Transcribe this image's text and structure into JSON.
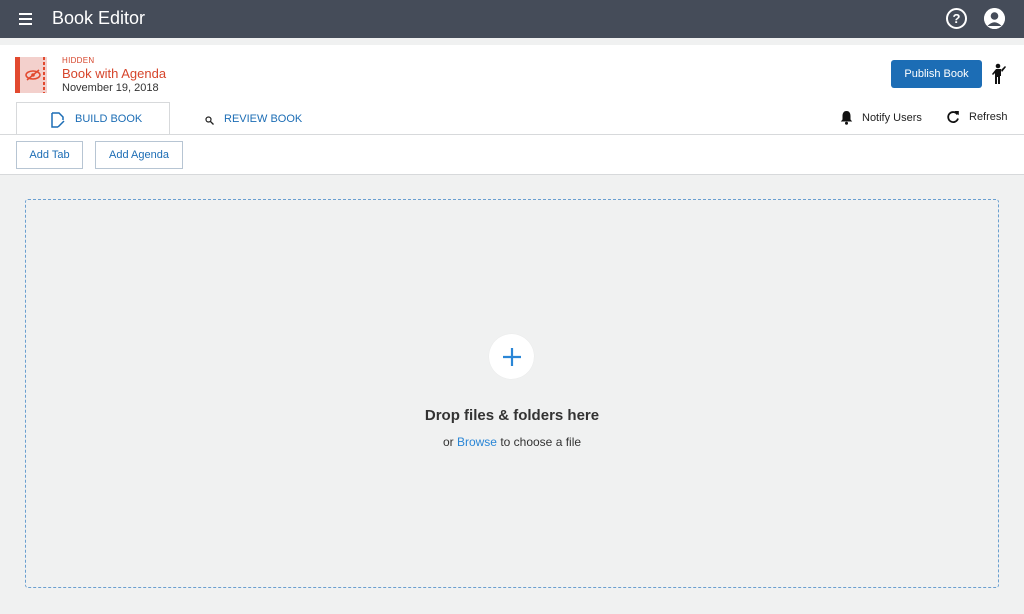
{
  "app": {
    "title": "Book Editor"
  },
  "topbar": {
    "menu_icon": "hamburger-icon",
    "help_icon": "help-icon",
    "help_glyph": "?",
    "avatar_icon": "user-avatar-icon"
  },
  "book": {
    "status": "HIDDEN",
    "title": "Book with Agenda",
    "date": "November 19, 2018",
    "thumb_icon": "hidden-eye-icon"
  },
  "header_actions": {
    "publish_label": "Publish Book",
    "accessibility_icon": "walking-person-icon"
  },
  "tabs": [
    {
      "label": "BUILD BOOK",
      "icon": "edit-document-icon",
      "active": true
    },
    {
      "label": "REVIEW BOOK",
      "icon": "search-icon",
      "active": false
    }
  ],
  "tab_actions": {
    "notify_label": "Notify Users",
    "notify_icon": "bell-icon",
    "refresh_label": "Refresh",
    "refresh_icon": "refresh-icon"
  },
  "toolbar": {
    "add_tab_label": "Add Tab",
    "add_agenda_label": "Add Agenda"
  },
  "dropzone": {
    "plus_icon": "plus-icon",
    "title": "Drop files & folders here",
    "sub_prefix": "or ",
    "browse_label": "Browse",
    "sub_suffix": " to choose a file"
  },
  "colors": {
    "topbar": "#454c59",
    "accent": "#1c6db5",
    "alert": "#d6452b",
    "link": "#2a86d6"
  }
}
